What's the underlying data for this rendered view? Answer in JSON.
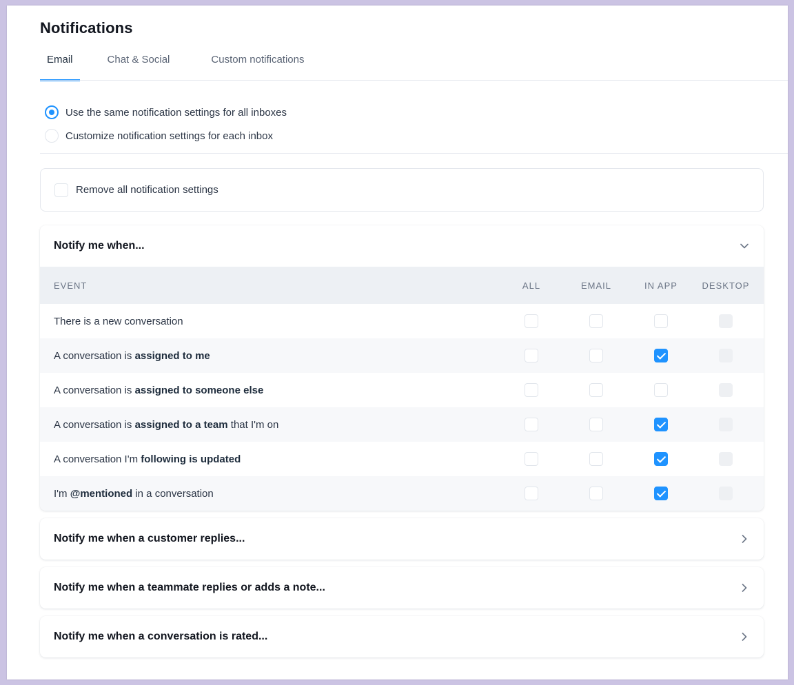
{
  "page": {
    "title": "Notifications"
  },
  "tabs": [
    {
      "label": "Email",
      "active": true
    },
    {
      "label": "Chat & Social",
      "active": false
    },
    {
      "label": "Custom notifications",
      "active": false
    }
  ],
  "inbox_mode": {
    "options": [
      {
        "label": "Use the same notification settings for all inboxes",
        "selected": true
      },
      {
        "label": "Customize notification settings for each inbox",
        "selected": false
      }
    ]
  },
  "remove_all": {
    "label": "Remove all notification settings",
    "checked": false
  },
  "notify_section": {
    "title": "Notify me when...",
    "expanded": true,
    "columns": {
      "event": "EVENT",
      "all": "ALL",
      "email": "EMAIL",
      "in_app": "IN APP",
      "desktop": "DESKTOP"
    },
    "rows": [
      {
        "parts": [
          "There is a new conversation"
        ],
        "bold": [
          false
        ],
        "all": false,
        "email": false,
        "in_app": false,
        "desktop": false
      },
      {
        "parts": [
          "A conversation is ",
          "assigned to me"
        ],
        "bold": [
          false,
          true
        ],
        "all": false,
        "email": false,
        "in_app": true,
        "desktop": false
      },
      {
        "parts": [
          "A conversation is ",
          "assigned to someone else"
        ],
        "bold": [
          false,
          true
        ],
        "all": false,
        "email": false,
        "in_app": false,
        "desktop": false
      },
      {
        "parts": [
          "A conversation is ",
          "assigned to a team",
          " that I'm on"
        ],
        "bold": [
          false,
          true,
          false
        ],
        "all": false,
        "email": false,
        "in_app": true,
        "desktop": false
      },
      {
        "parts": [
          "A conversation I'm ",
          "following is updated"
        ],
        "bold": [
          false,
          true
        ],
        "all": false,
        "email": false,
        "in_app": true,
        "desktop": false
      },
      {
        "parts": [
          "I'm ",
          "@mentioned",
          " in a conversation"
        ],
        "bold": [
          false,
          true,
          false
        ],
        "all": false,
        "email": false,
        "in_app": true,
        "desktop": false
      }
    ]
  },
  "collapsed_sections": [
    {
      "title": "Notify me when a customer replies..."
    },
    {
      "title": "Notify me when a teammate replies or adds a note..."
    },
    {
      "title": "Notify me when a conversation is rated..."
    }
  ],
  "colors": {
    "accent": "#1f93ff",
    "background": "#cbc3e3",
    "header_row": "#edf0f4"
  },
  "icons": {
    "expanded": "chevron-down-icon",
    "collapsed": "chevron-right-icon"
  }
}
